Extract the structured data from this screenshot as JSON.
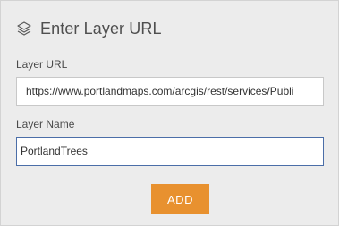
{
  "header": {
    "icon": "layers-icon",
    "title": "Enter Layer URL"
  },
  "layer_url": {
    "label": "Layer URL",
    "value": "https://www.portlandmaps.com/arcgis/rest/services/Publi"
  },
  "layer_name": {
    "label": "Layer Name",
    "value": "PortlandTrees"
  },
  "actions": {
    "add_label": "ADD"
  },
  "colors": {
    "accent": "#e8912f",
    "focus_border": "#4b6ea8",
    "panel_bg": "#ececec"
  }
}
